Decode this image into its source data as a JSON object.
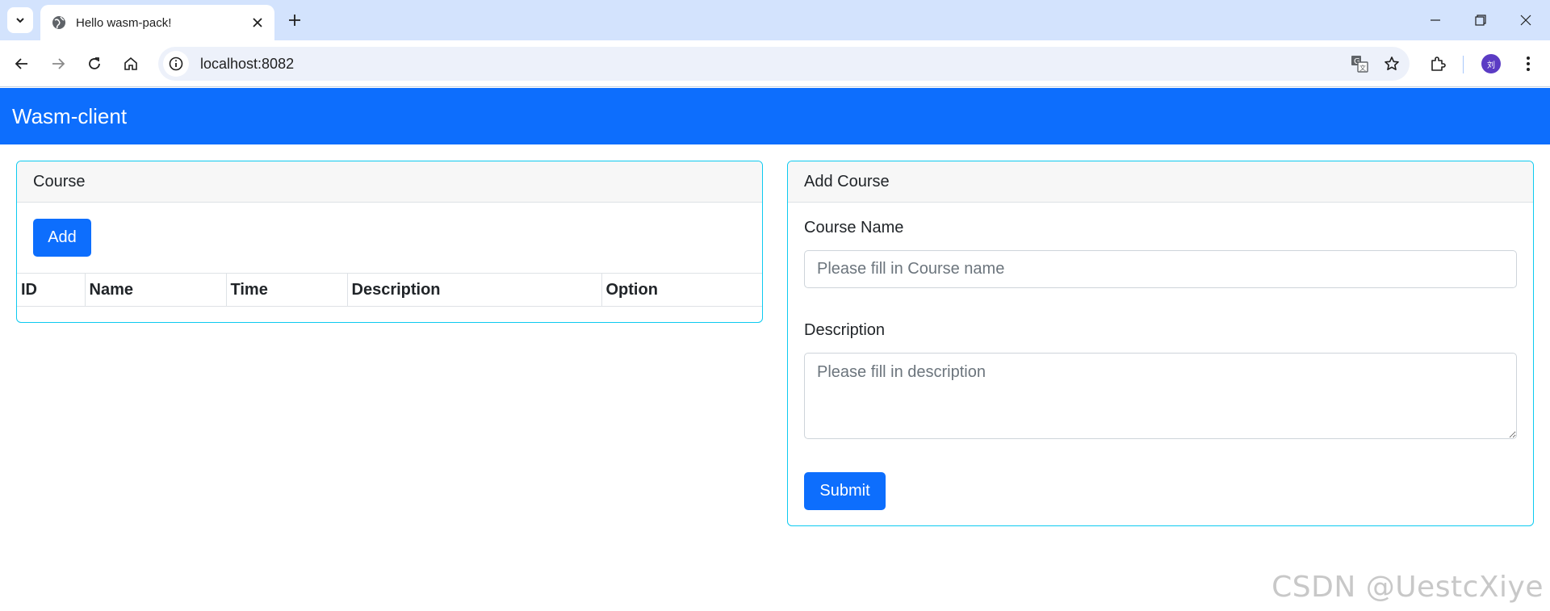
{
  "browser": {
    "tab_title": "Hello wasm-pack!",
    "url": "localhost:8082",
    "avatar_initial": "刘",
    "icons": {
      "tab_search": "chevron-down-icon",
      "favicon": "globe-icon",
      "tab_close": "close-icon",
      "new_tab": "plus-icon",
      "minimize": "minimize-icon",
      "restore": "restore-icon",
      "close_window": "close-icon",
      "back": "arrow-left-icon",
      "forward": "arrow-right-icon",
      "reload": "reload-icon",
      "home": "home-icon",
      "site_info": "info-icon",
      "translate": "translate-icon",
      "bookmark": "star-icon",
      "extensions": "puzzle-icon",
      "menu": "more-vert-icon"
    }
  },
  "navbar": {
    "brand": "Wasm-client",
    "color": "#0d6efd"
  },
  "course_card": {
    "header": "Course",
    "add_button": "Add",
    "table": {
      "columns": [
        "ID",
        "Name",
        "Time",
        "Description",
        "Option"
      ],
      "rows": []
    }
  },
  "add_course_card": {
    "header": "Add Course",
    "course_name_label": "Course Name",
    "course_name_placeholder": "Please fill in Course name",
    "course_name_value": "",
    "description_label": "Description",
    "description_placeholder": "Please fill in description",
    "description_value": "",
    "submit_button": "Submit"
  },
  "watermark": "CSDN @UestcXiye",
  "colors": {
    "primary": "#0d6efd",
    "card_border": "#0dcaf0",
    "tabstrip": "#d3e3fd"
  }
}
